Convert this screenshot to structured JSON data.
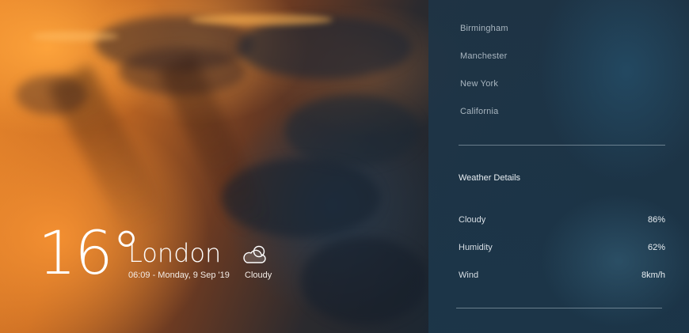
{
  "current": {
    "temperature": "16°",
    "city": "London",
    "datetime": "06:09 - Monday, 9 Sep '19",
    "condition": "Cloudy",
    "condition_icon": "cloud-sun-icon"
  },
  "sidebar": {
    "cities": [
      "Birmingham",
      "Manchester",
      "New York",
      "California"
    ],
    "details_title": "Weather Details",
    "details": [
      {
        "label": "Cloudy",
        "value": "86%"
      },
      {
        "label": "Humidity",
        "value": "62%"
      },
      {
        "label": "Wind",
        "value": "8km/h"
      }
    ]
  },
  "colors": {
    "sunset_orange": "#e8862b",
    "panel_blue": "#1e3446",
    "muted_text": "#a9b6c0"
  }
}
